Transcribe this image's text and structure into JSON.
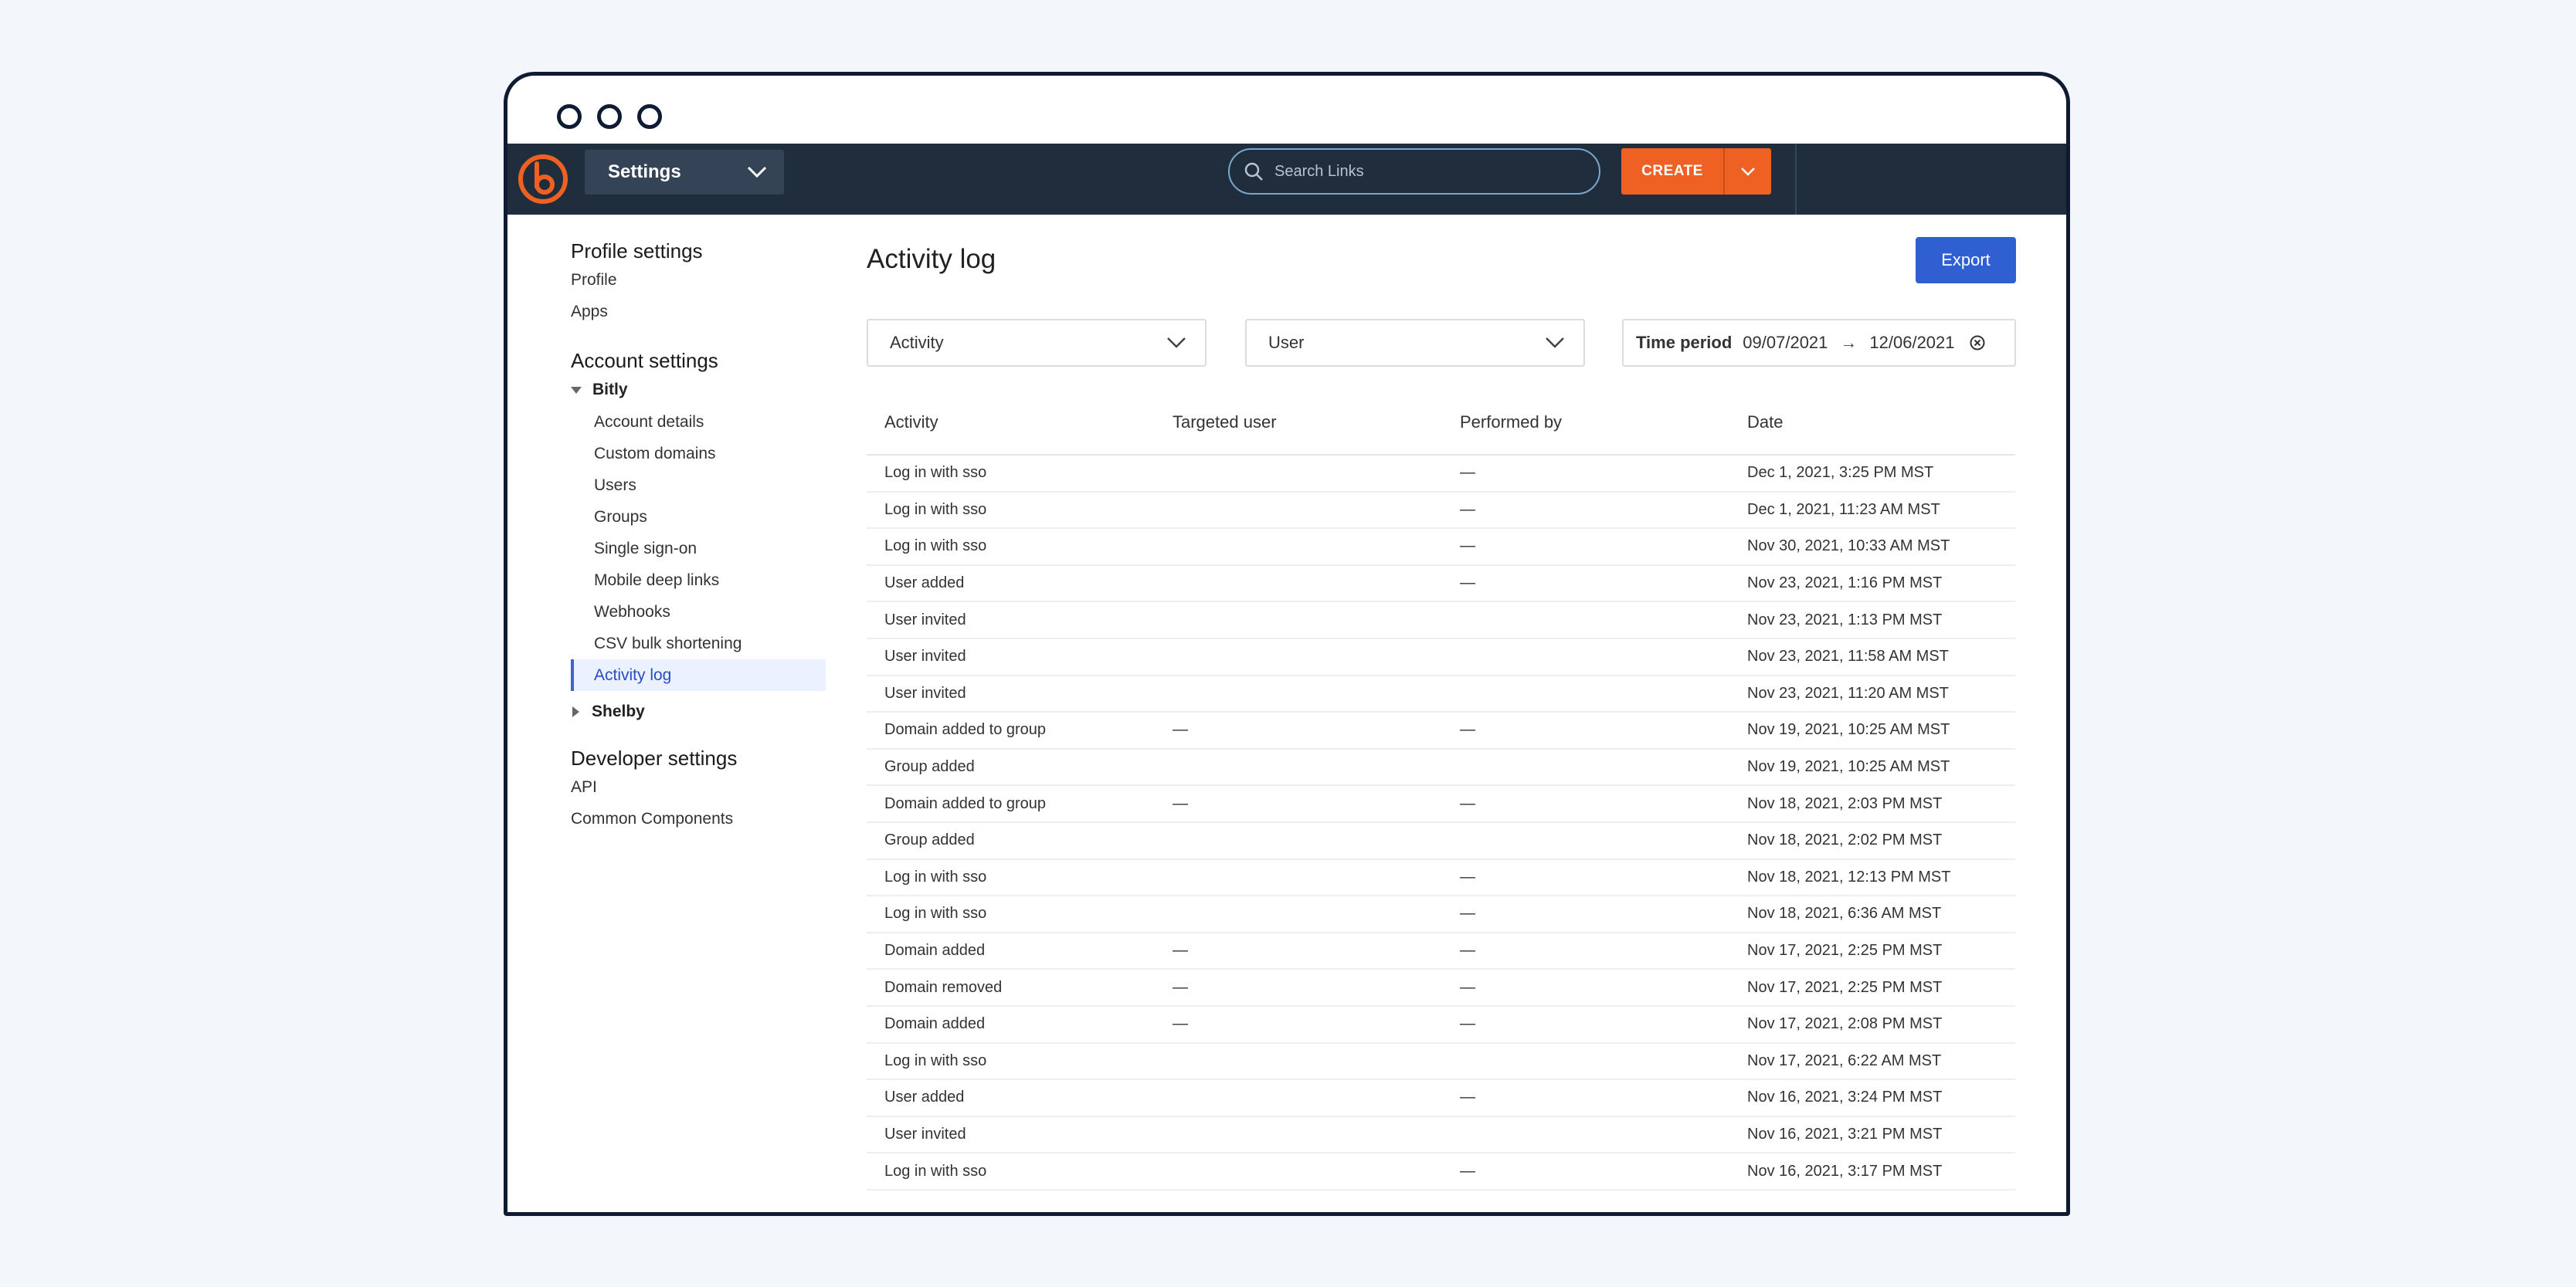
{
  "topbar": {
    "settings_label": "Settings",
    "search_placeholder": "Search Links",
    "create_label": "CREATE"
  },
  "sidebar": {
    "profile_heading": "Profile settings",
    "profile_items": [
      "Profile",
      "Apps"
    ],
    "account_heading": "Account settings",
    "group_bitly": "Bitly",
    "bitly_items": [
      "Account details",
      "Custom domains",
      "Users",
      "Groups",
      "Single sign-on",
      "Mobile deep links",
      "Webhooks",
      "CSV bulk shortening",
      "Activity log"
    ],
    "group_shelby": "Shelby",
    "developer_heading": "Developer settings",
    "developer_items": [
      "API",
      "Common Components"
    ]
  },
  "main": {
    "title": "Activity log",
    "export_label": "Export",
    "filter_activity": "Activity",
    "filter_user": "User",
    "time_period_label": "Time period",
    "time_start": "09/07/2021",
    "time_arrow": "→",
    "time_end": "12/06/2021"
  },
  "table": {
    "headers": [
      "Activity",
      "Targeted user",
      "Performed by",
      "Date"
    ],
    "rows": [
      {
        "activity": "Log in with sso",
        "targeted": "",
        "performed": "—",
        "date": "Dec 1, 2021, 3:25 PM MST"
      },
      {
        "activity": "Log in with sso",
        "targeted": "",
        "performed": "—",
        "date": "Dec 1, 2021, 11:23 AM MST"
      },
      {
        "activity": "Log in with sso",
        "targeted": "",
        "performed": "—",
        "date": "Nov 30, 2021, 10:33 AM MST"
      },
      {
        "activity": "User added",
        "targeted": "",
        "performed": "—",
        "date": "Nov 23, 2021, 1:16 PM MST"
      },
      {
        "activity": "User invited",
        "targeted": "",
        "performed": "",
        "date": "Nov 23, 2021, 1:13 PM MST"
      },
      {
        "activity": "User invited",
        "targeted": "",
        "performed": "",
        "date": "Nov 23, 2021, 11:58 AM MST"
      },
      {
        "activity": "User invited",
        "targeted": "",
        "performed": "",
        "date": "Nov 23, 2021, 11:20 AM MST"
      },
      {
        "activity": "Domain added to group",
        "targeted": "—",
        "performed": "—",
        "date": "Nov 19, 2021, 10:25 AM MST"
      },
      {
        "activity": "Group added",
        "targeted": "",
        "performed": "",
        "date": "Nov 19, 2021, 10:25 AM MST"
      },
      {
        "activity": "Domain added to group",
        "targeted": "—",
        "performed": "—",
        "date": "Nov 18, 2021, 2:03 PM MST"
      },
      {
        "activity": "Group added",
        "targeted": "",
        "performed": "",
        "date": "Nov 18, 2021, 2:02 PM MST"
      },
      {
        "activity": "Log in with sso",
        "targeted": "",
        "performed": "—",
        "date": "Nov 18, 2021, 12:13 PM MST"
      },
      {
        "activity": "Log in with sso",
        "targeted": "",
        "performed": "—",
        "date": "Nov 18, 2021, 6:36 AM MST"
      },
      {
        "activity": "Domain added",
        "targeted": "—",
        "performed": "—",
        "date": "Nov 17, 2021, 2:25 PM MST"
      },
      {
        "activity": "Domain removed",
        "targeted": "—",
        "performed": "—",
        "date": "Nov 17, 2021, 2:25 PM MST"
      },
      {
        "activity": "Domain added",
        "targeted": "—",
        "performed": "—",
        "date": "Nov 17, 2021, 2:08 PM MST"
      },
      {
        "activity": "Log in with sso",
        "targeted": "",
        "performed": "",
        "date": "Nov 17, 2021, 6:22 AM MST"
      },
      {
        "activity": "User added",
        "targeted": "",
        "performed": "—",
        "date": "Nov 16, 2021, 3:24 PM MST"
      },
      {
        "activity": "User invited",
        "targeted": "",
        "performed": "",
        "date": "Nov 16, 2021, 3:21 PM MST"
      },
      {
        "activity": "Log in with sso",
        "targeted": "",
        "performed": "—",
        "date": "Nov 16, 2021, 3:17 PM MST"
      }
    ]
  },
  "colors": {
    "topbar": "#1f2d3d",
    "brand_orange": "#ee6123",
    "link_blue": "#2946c8",
    "export_blue": "#2f5fd0"
  }
}
